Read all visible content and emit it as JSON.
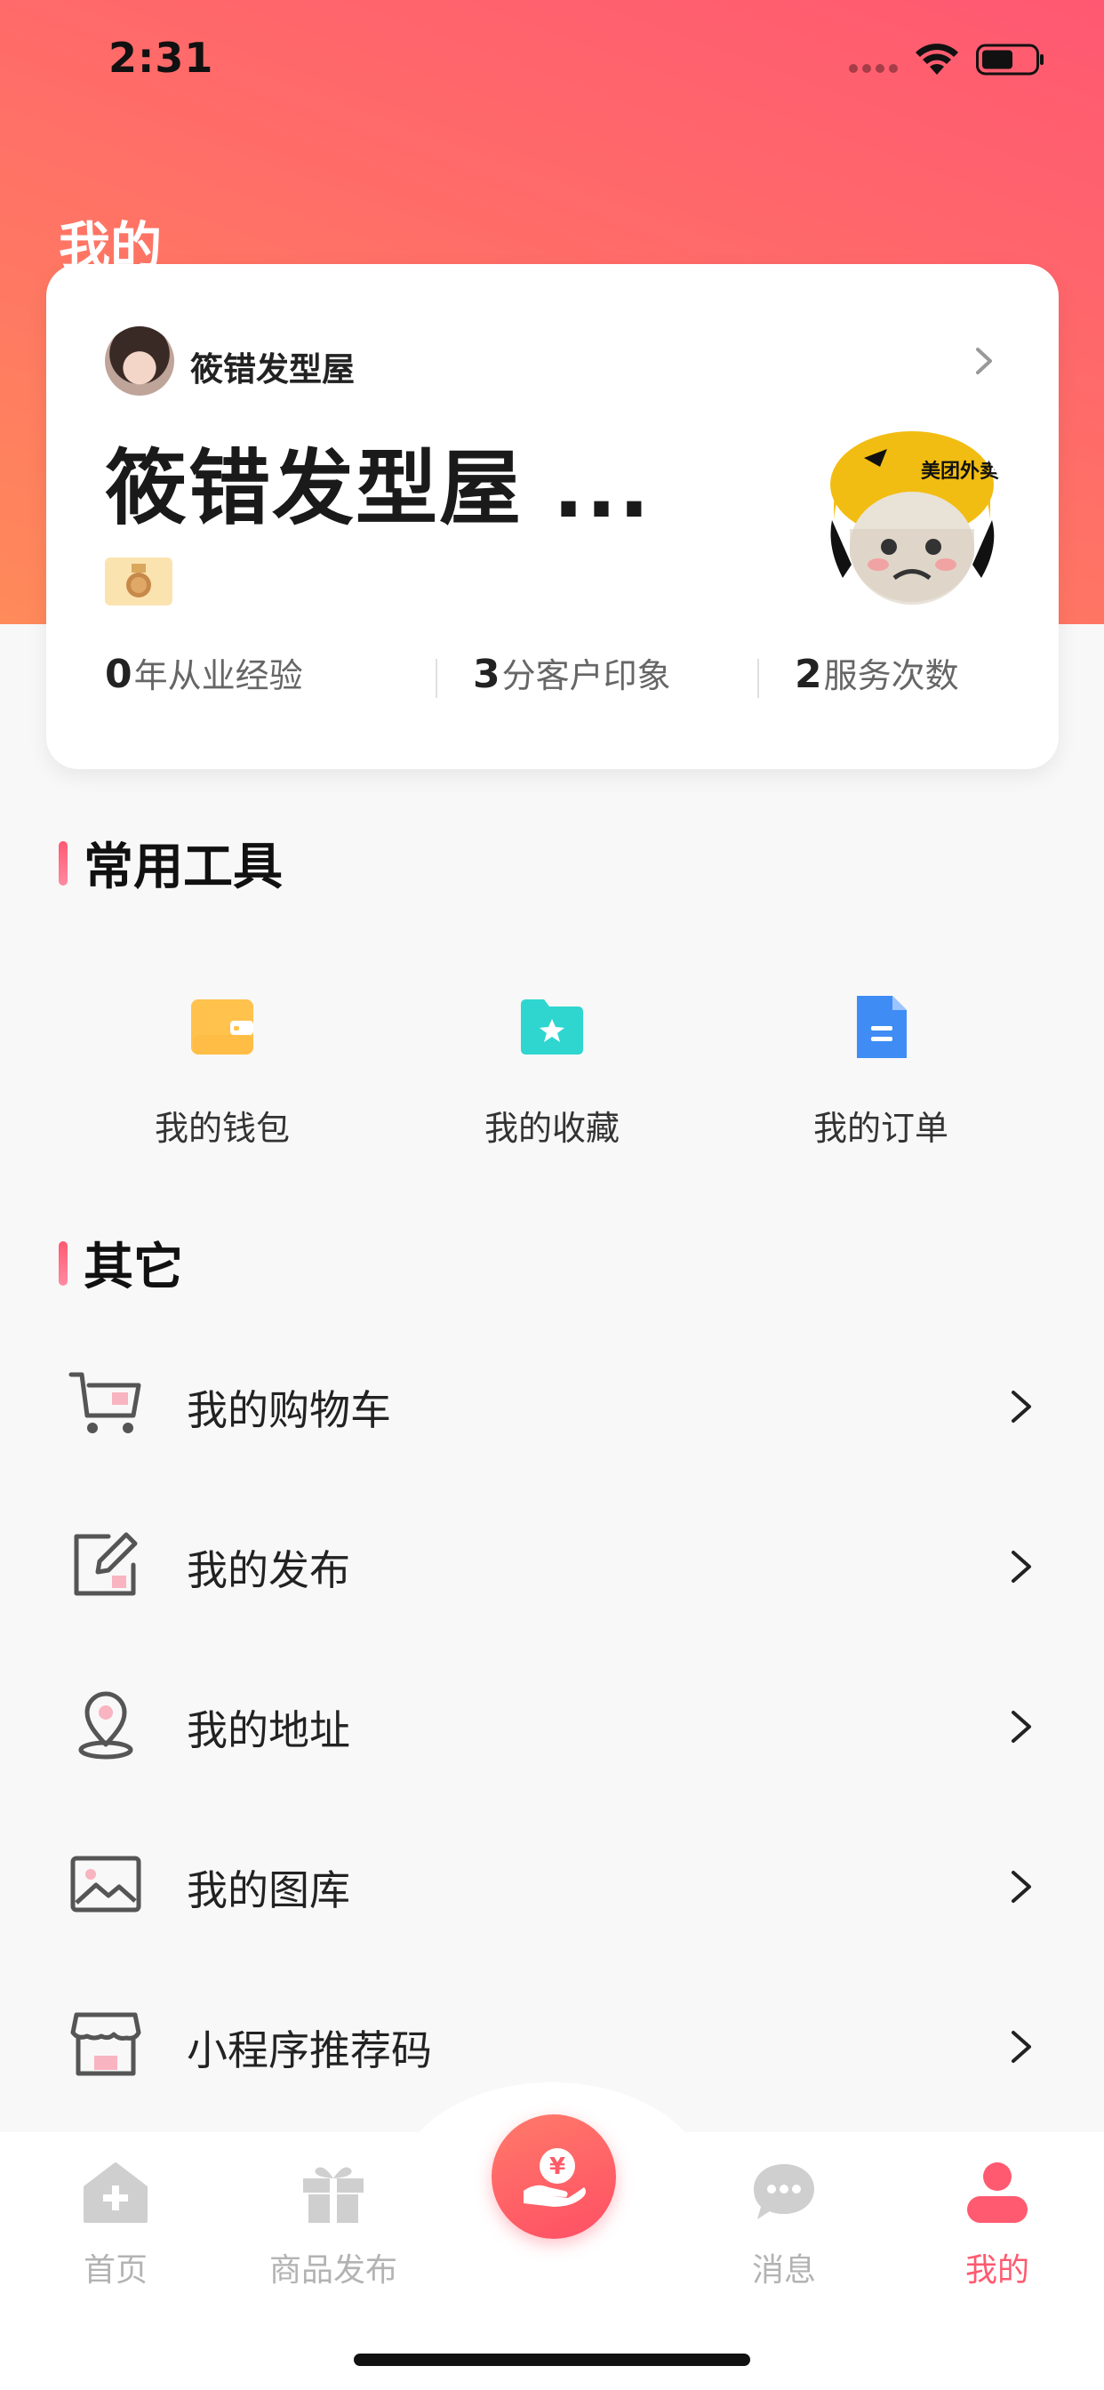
{
  "status_bar": {
    "time": "2:31"
  },
  "page_title": "我的",
  "profile": {
    "shop_name_small": "筱错发型屋",
    "shop_name_large": "筱错发型屋 ...",
    "stats": [
      {
        "value": "0",
        "label": "年从业经验"
      },
      {
        "value": "3",
        "label": "分客户印象"
      },
      {
        "value": "2",
        "label": "服务次数"
      }
    ],
    "avatar_text": "美团外卖"
  },
  "tools_section": {
    "title": "常用工具",
    "items": [
      {
        "label": "我的钱包",
        "icon": "wallet-icon",
        "color": "#ffc24d"
      },
      {
        "label": "我的收藏",
        "icon": "star-folder-icon",
        "color": "#2fd6cf"
      },
      {
        "label": "我的订单",
        "icon": "document-icon",
        "color": "#3f8cf5"
      }
    ]
  },
  "others_section": {
    "title": "其它",
    "items": [
      {
        "label": "我的购物车",
        "icon": "cart-icon"
      },
      {
        "label": "我的发布",
        "icon": "edit-icon"
      },
      {
        "label": "我的地址",
        "icon": "location-pin-icon"
      },
      {
        "label": "我的图库",
        "icon": "image-icon"
      },
      {
        "label": "小程序推荐码",
        "icon": "store-icon"
      }
    ]
  },
  "tab_bar": {
    "items": [
      {
        "label": "首页",
        "icon": "home-plus-icon"
      },
      {
        "label": "商品发布",
        "icon": "gift-icon"
      },
      {
        "label": "",
        "icon": "hand-yen-icon"
      },
      {
        "label": "消息",
        "icon": "chat-bubble-icon"
      },
      {
        "label": "我的",
        "icon": "user-icon",
        "active": true
      }
    ],
    "center_symbol": "¥"
  },
  "colors": {
    "accent": "#ff5a70",
    "header_gradient_start": "#ff5872",
    "header_gradient_end": "#ff8a5a"
  }
}
